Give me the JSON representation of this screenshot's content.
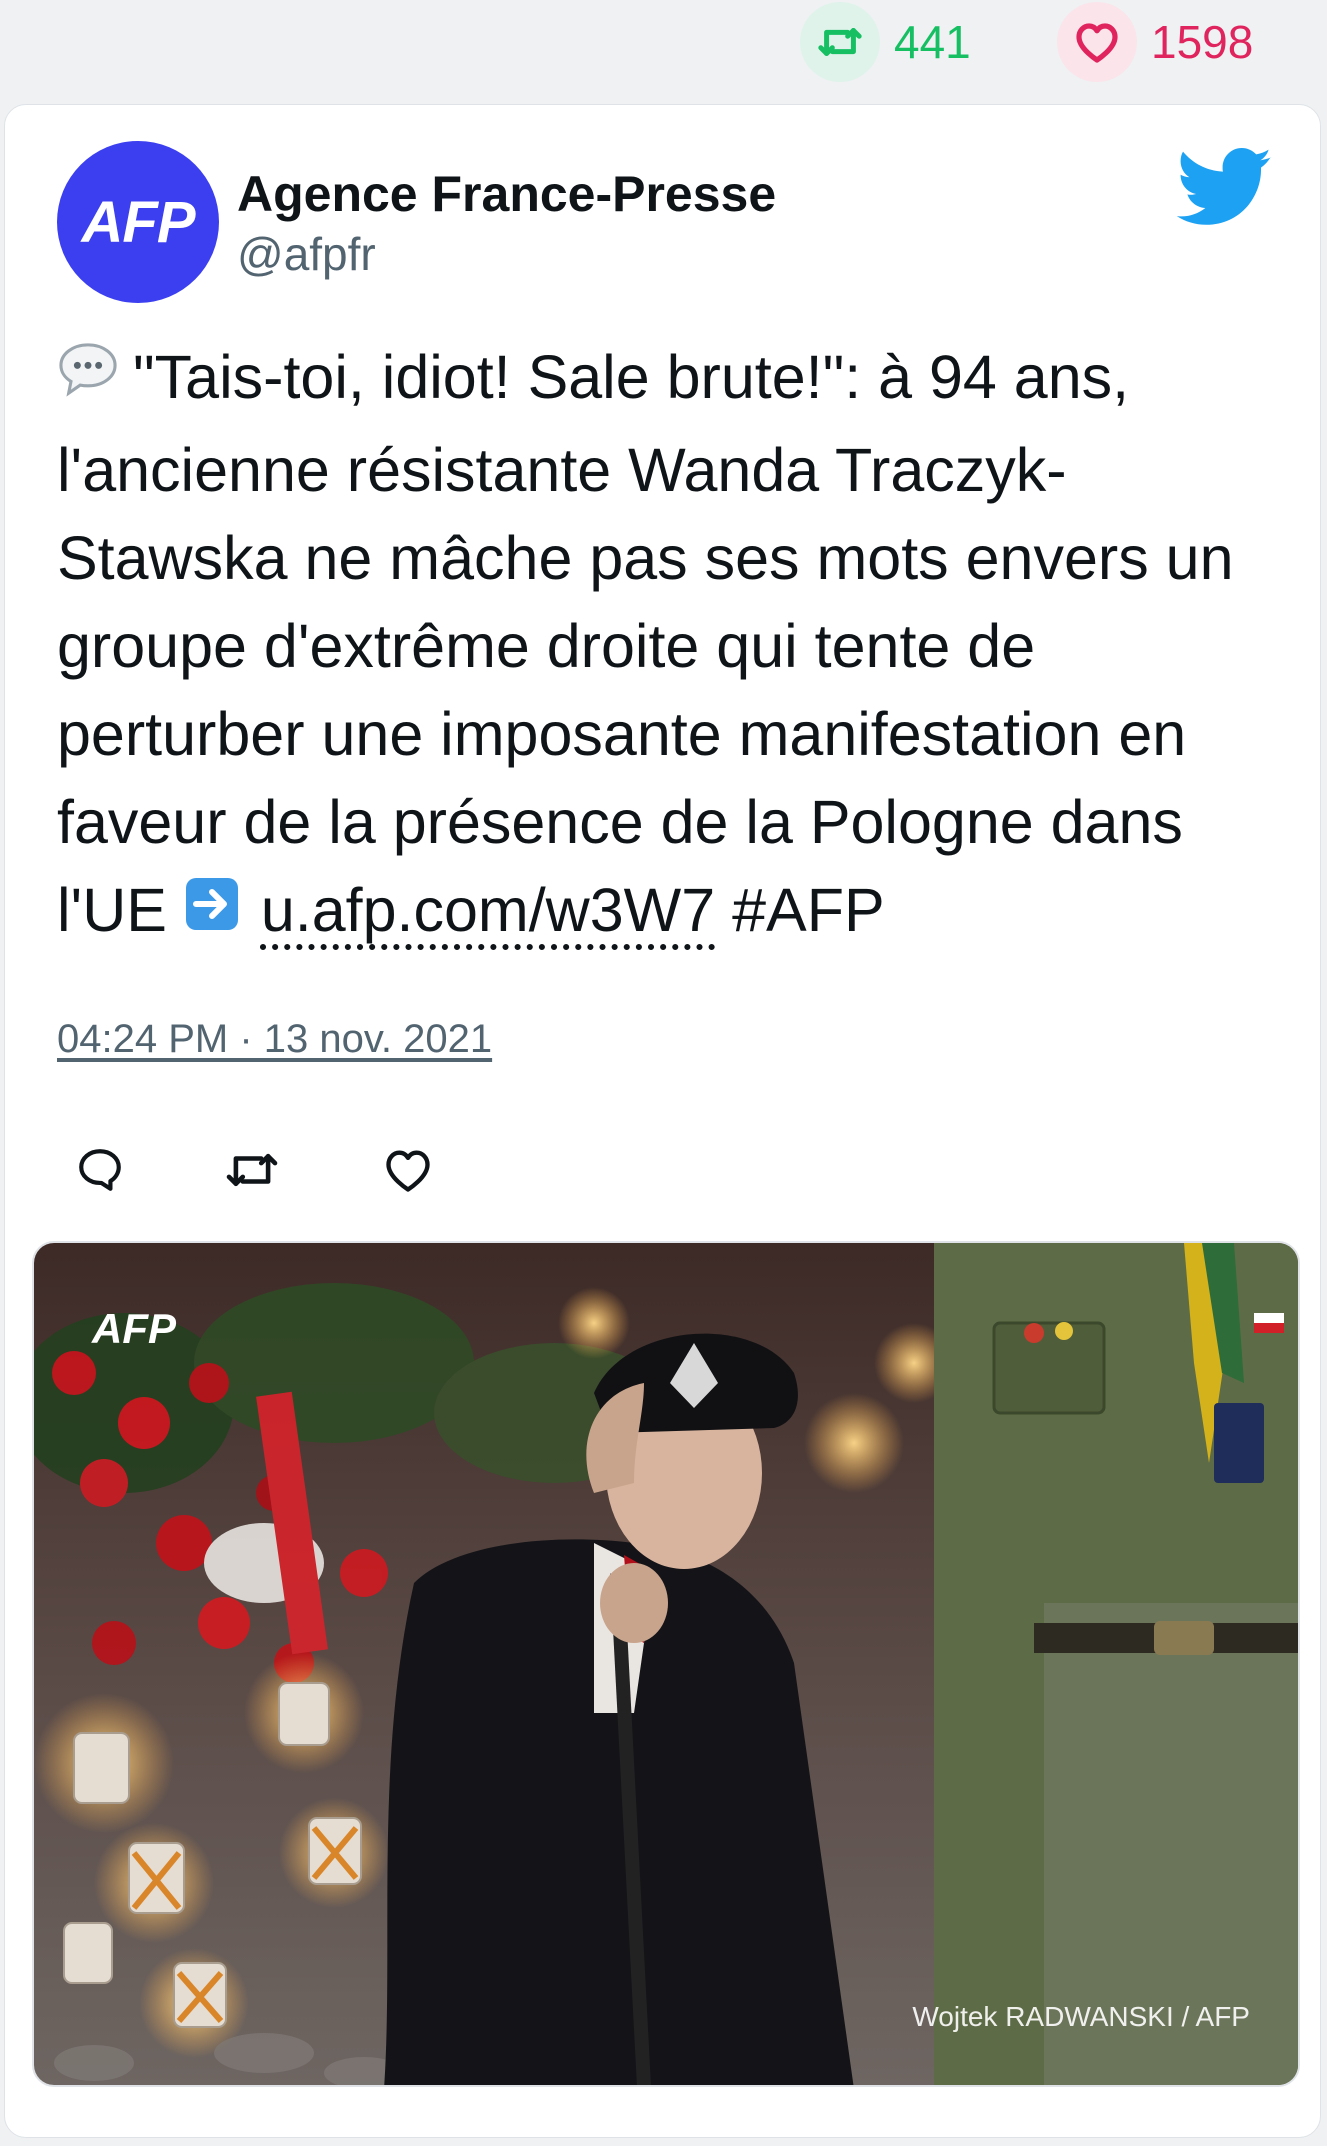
{
  "stats": {
    "retweets": "441",
    "likes": "1598"
  },
  "tweet": {
    "author_name": "Agence France-Presse",
    "author_handle": "@afpfr",
    "avatar_text": "AFP",
    "text_part1": "\"Tais-toi, idiot! Sale brute!\": à 94 ans, l'ancienne résistante Wanda Traczyk-Stawska ne mâche pas ses mots envers un groupe d'extrême droite qui tente de perturber une imposante manifestation en faveur de la présence de la Pologne dans l'UE",
    "link": "u.afp.com/w3W7",
    "hashtag": "#AFP",
    "timestamp": "04:24 PM · 13 nov. 2021"
  },
  "media": {
    "logo": "AFP",
    "credit": "Wojtek RADWANSKI / AFP"
  },
  "icons": {
    "retweet": "retweet-icon",
    "like": "heart-icon",
    "reply": "reply-icon",
    "bird": "twitter-bird-icon",
    "speech": "speech-balloon-icon",
    "arrow": "right-arrow-icon"
  },
  "colors": {
    "retweet_green": "#17bf63",
    "like_red": "#e0245e",
    "avatar_blue": "#3b3ff0",
    "twitter_blue": "#1da1f2"
  }
}
